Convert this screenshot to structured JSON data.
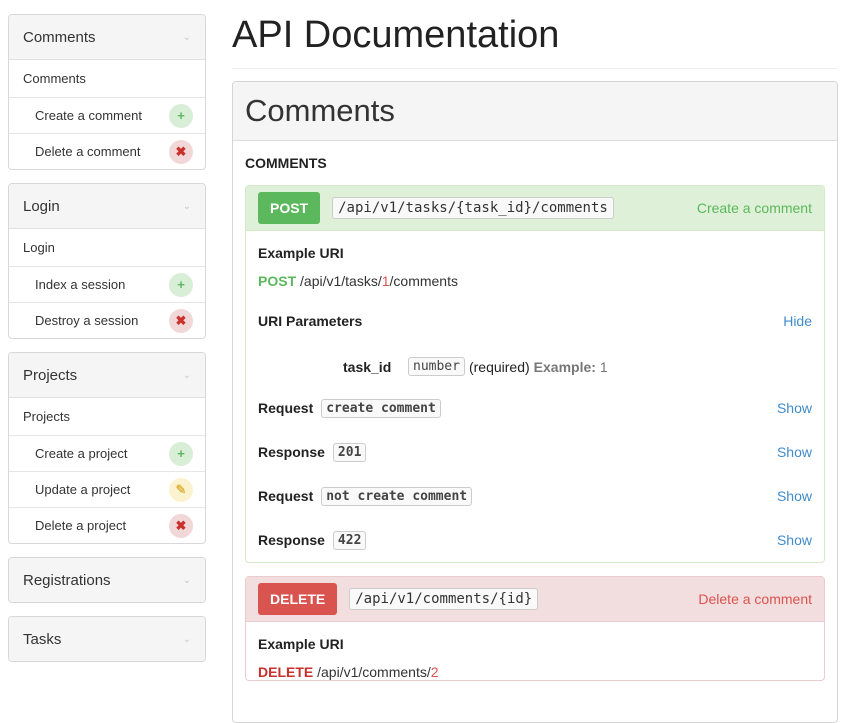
{
  "sidebar": {
    "groups": [
      {
        "title": "Comments",
        "sub": "Comments",
        "items": [
          {
            "label": "Create a comment",
            "icon": "+"
          },
          {
            "label": "Delete a comment",
            "icon": "✖"
          }
        ]
      },
      {
        "title": "Login",
        "sub": "Login",
        "items": [
          {
            "label": "Index a session",
            "icon": "+"
          },
          {
            "label": "Destroy a session",
            "icon": "✖"
          }
        ]
      },
      {
        "title": "Projects",
        "sub": "Projects",
        "items": [
          {
            "label": "Create a project",
            "icon": "+"
          },
          {
            "label": "Update a project",
            "icon": "✎"
          },
          {
            "label": "Delete a project",
            "icon": "✖"
          }
        ]
      },
      {
        "title": "Registrations"
      },
      {
        "title": "Tasks"
      }
    ],
    "chevron": "⌄"
  },
  "main": {
    "page_title": "API Documentation",
    "group_title": "Comments",
    "resource_title": "COMMENTS",
    "post_action": {
      "method": "POST",
      "uri": "/api/v1/tasks/{task_id}/comments",
      "name": "Create a comment",
      "example_uri_label": "Example URI",
      "example_method": "POST",
      "example_path_before": " /api/v1/tasks/",
      "example_param": "1",
      "example_path_after": "/comments",
      "uri_params_label": "URI Parameters",
      "hide_label": "Hide",
      "param_name": "task_id",
      "param_type": "number",
      "param_required": "(required)",
      "param_example_label": "Example:",
      "param_example_value": "1",
      "rr": [
        {
          "label": "Request",
          "code": "create comment",
          "link": "Show"
        },
        {
          "label": "Response",
          "code": "201",
          "link": "Show"
        },
        {
          "label": "Request",
          "code": "not create comment",
          "link": "Show"
        },
        {
          "label": "Response",
          "code": "422",
          "link": "Show"
        }
      ]
    },
    "delete_action": {
      "method": "DELETE",
      "uri": "/api/v1/comments/{id}",
      "name": "Delete a comment",
      "example_uri_label": "Example URI",
      "example_method": "DELETE",
      "example_path_before": " /api/v1/comments/",
      "example_param": "2"
    }
  },
  "colors": {
    "post": "#5cb85c",
    "delete": "#d9534f",
    "link": "#428bca"
  }
}
